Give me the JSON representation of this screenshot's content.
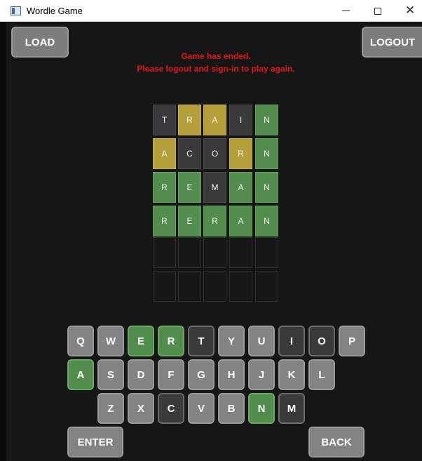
{
  "window": {
    "title": "Wordle Game",
    "minimize_glyph": "",
    "maximize_glyph": "",
    "close_glyph": "✕"
  },
  "toolbar": {
    "load_label": "LOAD",
    "logout_label": "LOGOUT"
  },
  "status": {
    "line1": "Game has ended.",
    "line2": "Please logout and sign-in to play again.",
    "color": "#e01818"
  },
  "board": {
    "rows": [
      [
        {
          "l": "T",
          "s": "gray"
        },
        {
          "l": "R",
          "s": "yellow"
        },
        {
          "l": "A",
          "s": "yellow"
        },
        {
          "l": "I",
          "s": "gray"
        },
        {
          "l": "N",
          "s": "green"
        }
      ],
      [
        {
          "l": "A",
          "s": "yellow"
        },
        {
          "l": "C",
          "s": "gray"
        },
        {
          "l": "O",
          "s": "gray"
        },
        {
          "l": "R",
          "s": "yellow"
        },
        {
          "l": "N",
          "s": "green"
        }
      ],
      [
        {
          "l": "R",
          "s": "green"
        },
        {
          "l": "E",
          "s": "green"
        },
        {
          "l": "M",
          "s": "gray"
        },
        {
          "l": "A",
          "s": "green"
        },
        {
          "l": "N",
          "s": "green"
        }
      ],
      [
        {
          "l": "R",
          "s": "green"
        },
        {
          "l": "E",
          "s": "green"
        },
        {
          "l": "R",
          "s": "green"
        },
        {
          "l": "A",
          "s": "green"
        },
        {
          "l": "N",
          "s": "green"
        }
      ],
      [
        {
          "l": "",
          "s": "empty"
        },
        {
          "l": "",
          "s": "empty"
        },
        {
          "l": "",
          "s": "empty"
        },
        {
          "l": "",
          "s": "empty"
        },
        {
          "l": "",
          "s": "empty"
        }
      ],
      [
        {
          "l": "",
          "s": "empty"
        },
        {
          "l": "",
          "s": "empty"
        },
        {
          "l": "",
          "s": "empty"
        },
        {
          "l": "",
          "s": "empty"
        },
        {
          "l": "",
          "s": "empty"
        }
      ]
    ],
    "colors": {
      "gray": "#3a3a3c",
      "yellow": "#b59f3b",
      "green": "#538d4e",
      "empty": "#171717"
    }
  },
  "keyboard": {
    "row1": [
      {
        "k": "Q",
        "s": "default"
      },
      {
        "k": "W",
        "s": "default"
      },
      {
        "k": "E",
        "s": "green"
      },
      {
        "k": "R",
        "s": "green"
      },
      {
        "k": "T",
        "s": "dark"
      },
      {
        "k": "Y",
        "s": "default"
      },
      {
        "k": "U",
        "s": "default"
      },
      {
        "k": "I",
        "s": "dark"
      },
      {
        "k": "O",
        "s": "dark"
      },
      {
        "k": "P",
        "s": "default"
      }
    ],
    "row2": [
      {
        "k": "A",
        "s": "green"
      },
      {
        "k": "S",
        "s": "default"
      },
      {
        "k": "D",
        "s": "default"
      },
      {
        "k": "F",
        "s": "default"
      },
      {
        "k": "G",
        "s": "default"
      },
      {
        "k": "H",
        "s": "default"
      },
      {
        "k": "J",
        "s": "default"
      },
      {
        "k": "K",
        "s": "default"
      },
      {
        "k": "L",
        "s": "default"
      }
    ],
    "row3": [
      {
        "k": "Z",
        "s": "default"
      },
      {
        "k": "X",
        "s": "default"
      },
      {
        "k": "C",
        "s": "dark"
      },
      {
        "k": "V",
        "s": "default"
      },
      {
        "k": "B",
        "s": "default"
      },
      {
        "k": "N",
        "s": "green"
      },
      {
        "k": "M",
        "s": "dark"
      }
    ],
    "enter_label": "ENTER",
    "back_label": "BACK"
  }
}
